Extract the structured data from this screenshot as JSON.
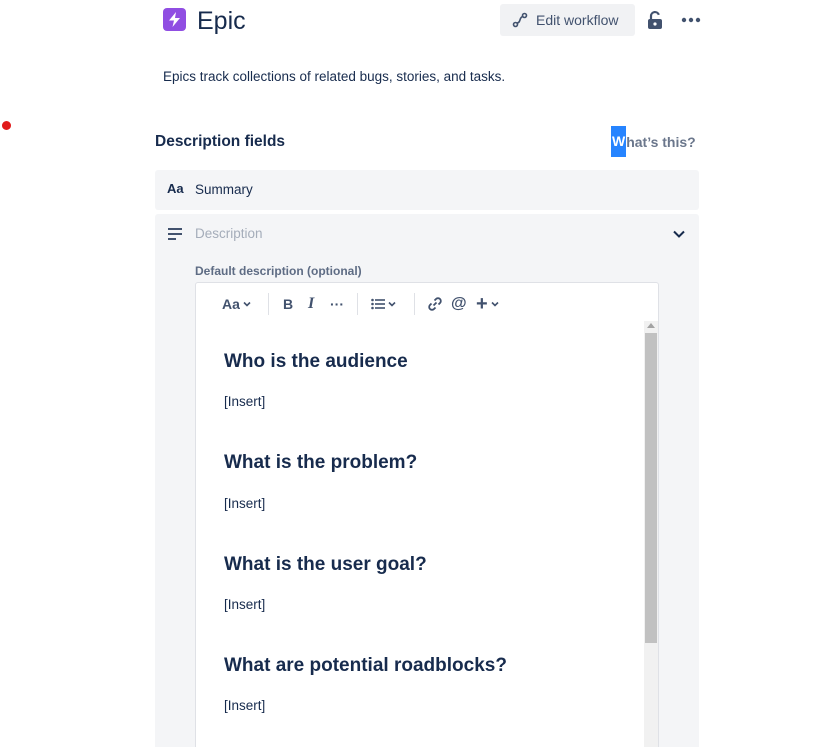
{
  "header": {
    "title": "Epic",
    "subtitle": "Epics track collections of related bugs, stories, and tasks.",
    "edit_workflow_label": "Edit workflow",
    "icon_color": "#904ee2"
  },
  "description_fields": {
    "heading": "Description fields",
    "help_link_first": "W",
    "help_link_rest": "hat’s this?"
  },
  "fields": {
    "summary": {
      "icon": "Aa",
      "label": "Summary"
    },
    "description": {
      "placeholder": "Description",
      "default_label": "Default description (optional)"
    }
  },
  "toolbar": {
    "text_style": "Aa",
    "bold": "B",
    "italic": "I",
    "more": "···",
    "list": "list-icon",
    "link": "link-icon",
    "mention": "@",
    "insert": "+"
  },
  "editor": {
    "sections": [
      {
        "heading": "Who is the audience",
        "body": "[Insert]"
      },
      {
        "heading": "What is the problem?",
        "body": "[Insert]"
      },
      {
        "heading": "What is the user goal?",
        "body": "[Insert]"
      },
      {
        "heading": "What are potential roadblocks?",
        "body": "[Insert]"
      }
    ]
  }
}
